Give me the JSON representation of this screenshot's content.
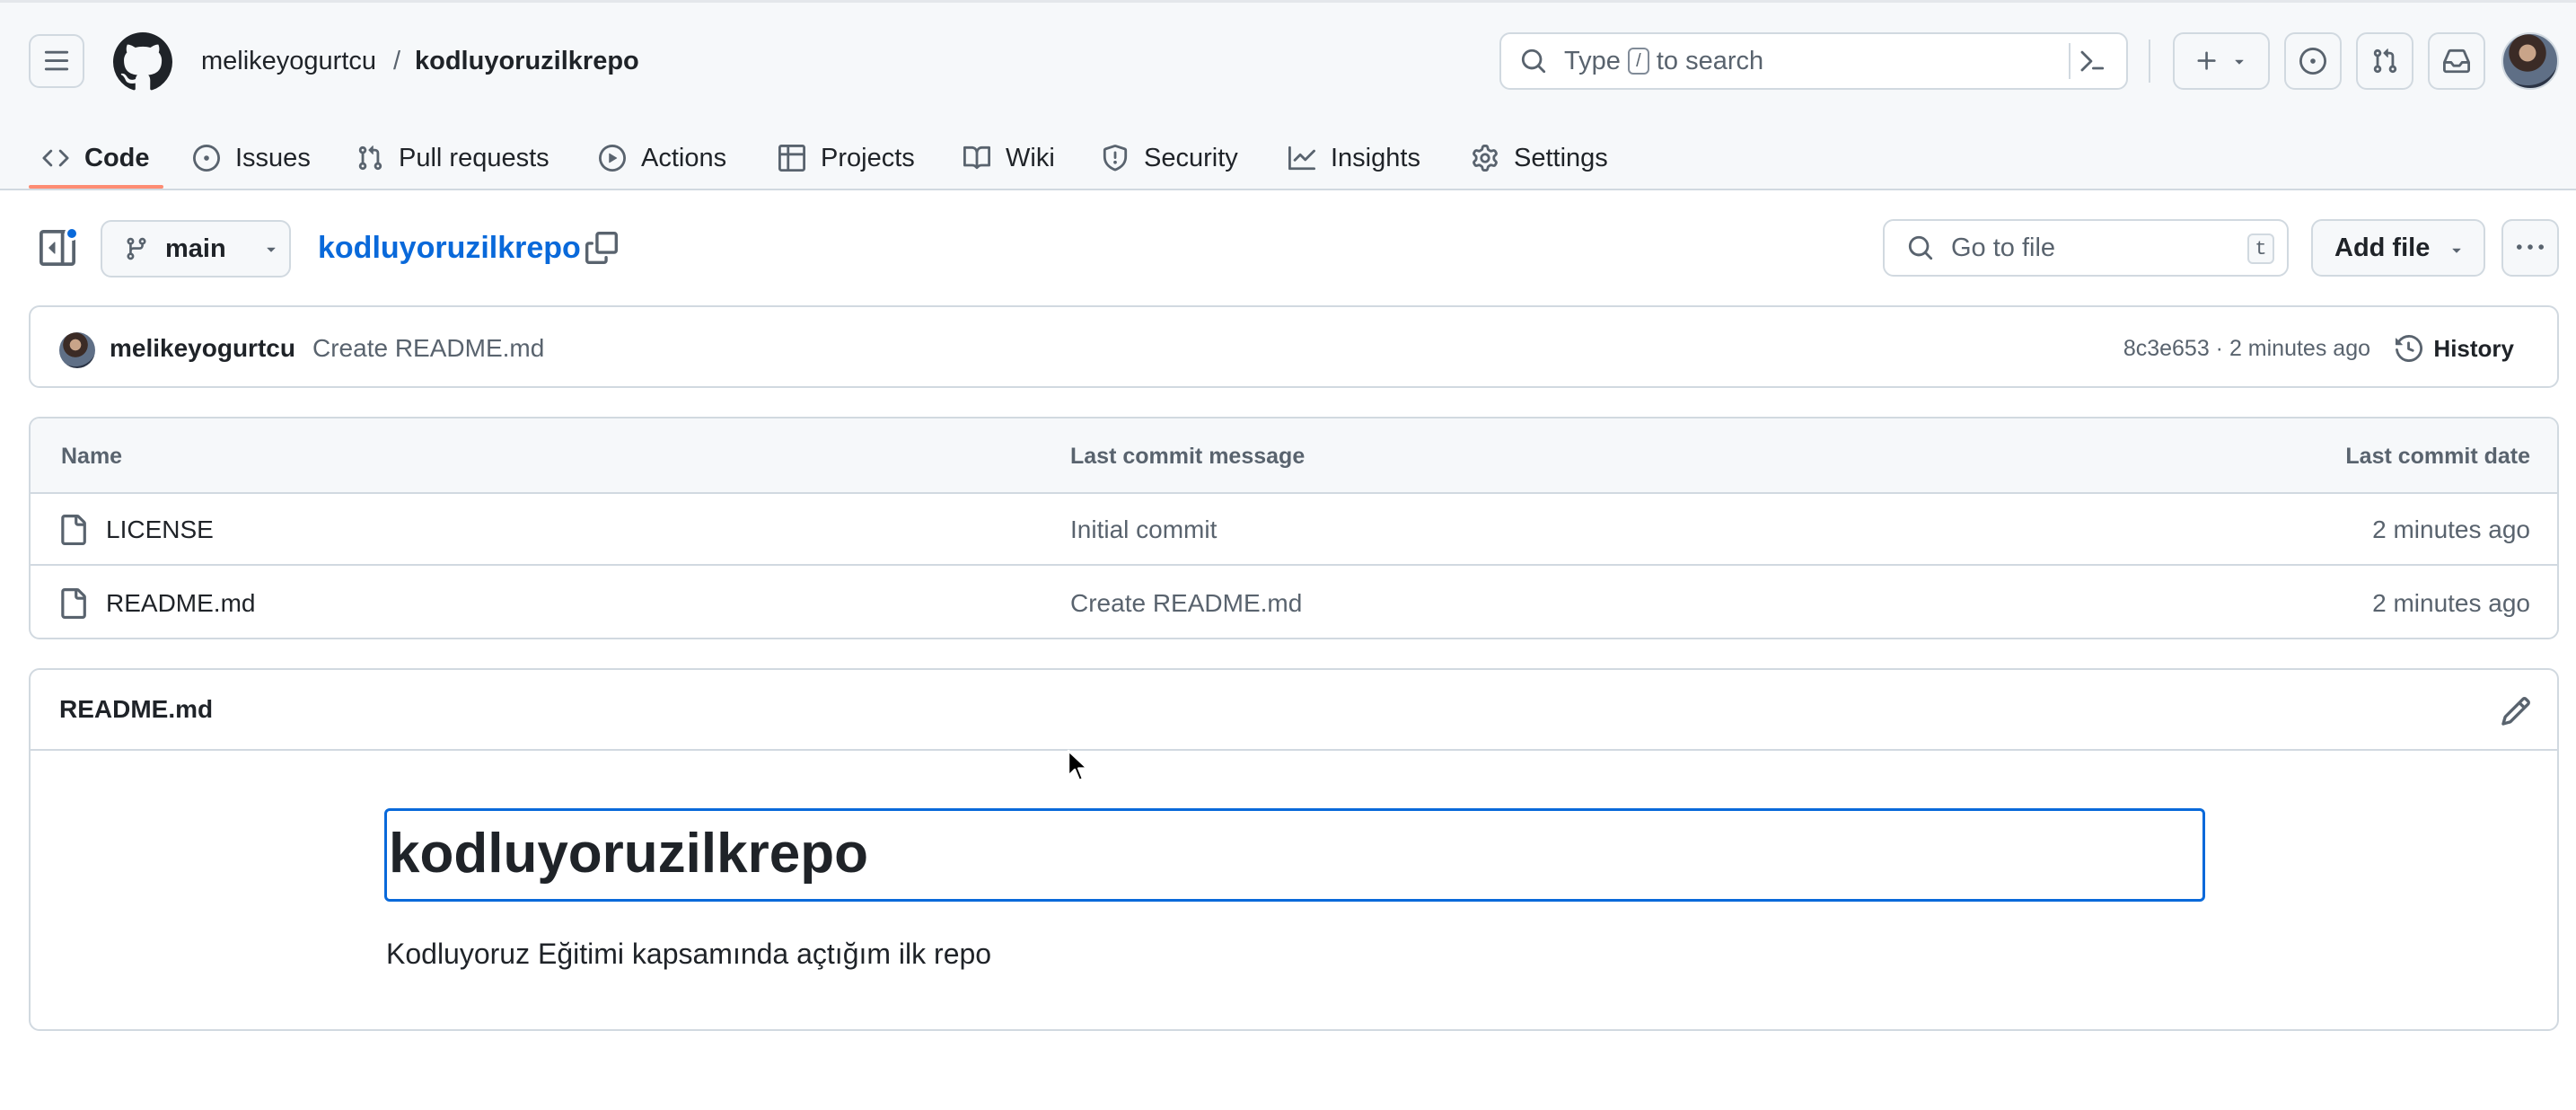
{
  "header": {
    "owner": "melikeyogurtcu",
    "separator": "/",
    "repo": "kodluyoruzilkrepo",
    "search": {
      "prefix": "Type",
      "key": "/",
      "suffix": "to search"
    },
    "icons": [
      "menu-icon",
      "github-logo",
      "search-icon",
      "command-palette-icon",
      "plus-icon",
      "issue-opened-icon",
      "pull-request-icon",
      "inbox-icon"
    ]
  },
  "nav": {
    "tabs": [
      {
        "label": "Code",
        "icon": "code-icon",
        "active": true
      },
      {
        "label": "Issues",
        "icon": "issue-opened-icon"
      },
      {
        "label": "Pull requests",
        "icon": "pull-request-icon"
      },
      {
        "label": "Actions",
        "icon": "play-icon"
      },
      {
        "label": "Projects",
        "icon": "table-icon"
      },
      {
        "label": "Wiki",
        "icon": "book-icon"
      },
      {
        "label": "Security",
        "icon": "shield-icon"
      },
      {
        "label": "Insights",
        "icon": "graph-icon"
      },
      {
        "label": "Settings",
        "icon": "gear-icon"
      }
    ]
  },
  "repo_bar": {
    "branch": "main",
    "repo_title": "kodluyoruzilkrepo",
    "goto_placeholder": "Go to file",
    "goto_shortcut": "t",
    "add_file": "Add file"
  },
  "commit": {
    "author": "melikeyogurtcu",
    "message": "Create README.md",
    "meta": "8c3e653 · 2 minutes ago",
    "history": "History"
  },
  "files": {
    "columns": [
      "Name",
      "Last commit message",
      "Last commit date"
    ],
    "rows": [
      {
        "name": "LICENSE",
        "message": "Initial commit",
        "date": "2 minutes ago"
      },
      {
        "name": "README.md",
        "message": "Create README.md",
        "date": "2 minutes ago"
      }
    ]
  },
  "readme": {
    "filename": "README.md",
    "heading": "kodluyoruzilkrepo",
    "paragraph": "Kodluyoruz Eğitimi kapsamında açtığım ilk repo"
  },
  "colors": {
    "accent": "#0969da",
    "tab_underline": "#fd8c73",
    "border": "#d1d9e0",
    "muted": "#59636e"
  }
}
